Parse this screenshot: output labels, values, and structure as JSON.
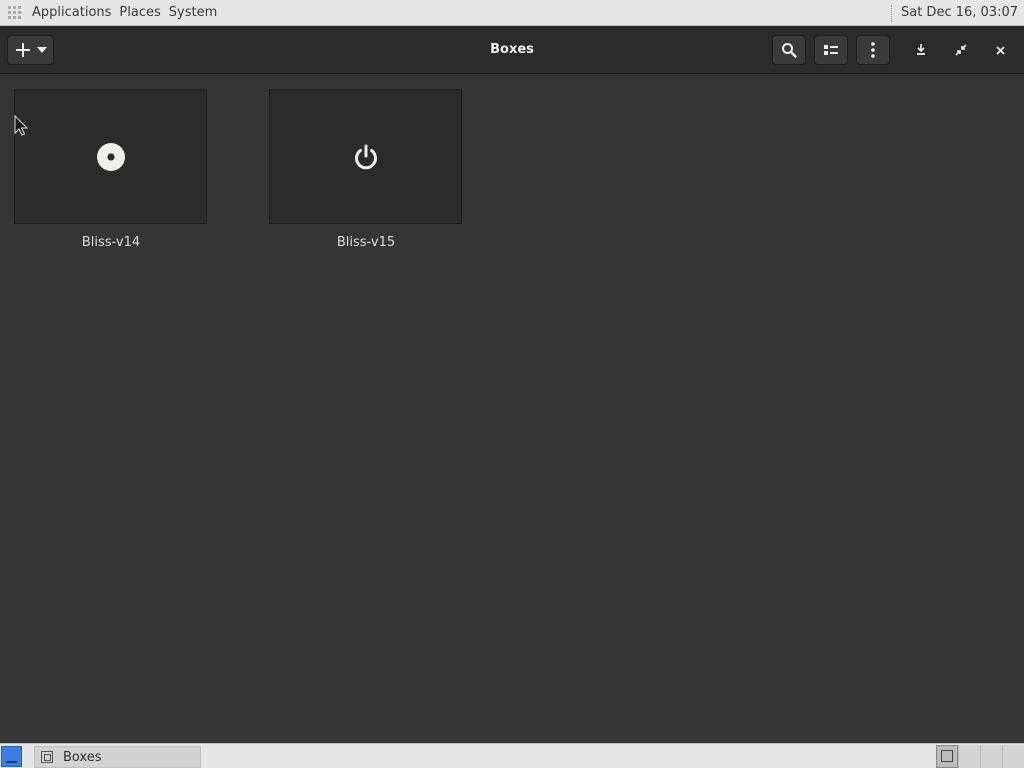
{
  "top_panel": {
    "menus": [
      "Applications",
      "Places",
      "System"
    ],
    "clock": "Sat Dec 16, 03:07"
  },
  "header": {
    "title": "Boxes",
    "icons": {
      "new": "plus-icon",
      "new_menu": "chevron-down-icon",
      "search": "search-icon",
      "view": "list-view-icon",
      "menu": "kebab-menu-icon",
      "minimize": "minimize-icon",
      "restore": "restore-icon",
      "close": "close-icon"
    }
  },
  "boxes": [
    {
      "name": "Bliss-v14",
      "icon": "disc-icon"
    },
    {
      "name": "Bliss-v15",
      "icon": "power-icon"
    }
  ],
  "taskbar": {
    "task_label": "Boxes"
  },
  "colors": {
    "panel_bg": "#e6e6e6",
    "headerbar_bg": "#2b2b2b",
    "content_bg": "#353535",
    "show_desktop": "#3d7de0"
  }
}
